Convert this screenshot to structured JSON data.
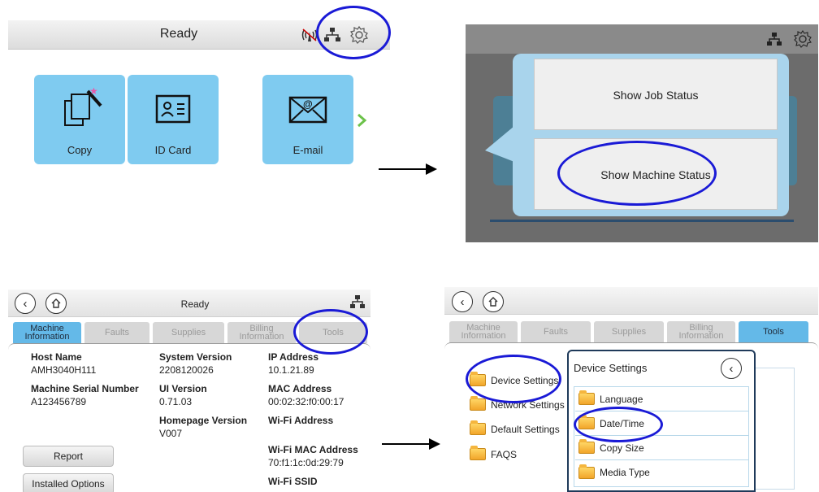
{
  "panel1": {
    "status": "Ready",
    "tiles": [
      {
        "label": "Copy",
        "icon": "copy-icon"
      },
      {
        "label": "ID Card",
        "icon": "id-card-icon"
      },
      {
        "label": "E-mail",
        "icon": "email-icon"
      }
    ],
    "next_icon": "chevron-right-icon"
  },
  "panel2": {
    "buttons": [
      "Show Job Status",
      "Show Machine Status"
    ]
  },
  "panel3": {
    "status": "Ready",
    "tabs": [
      "Machine Information",
      "Faults",
      "Supplies",
      "Billing Information",
      "Tools"
    ],
    "active_tab": "Machine Information",
    "info": {
      "host_name": {
        "label": "Host Name",
        "value": "AMH3040H111"
      },
      "serial": {
        "label": "Machine Serial Number",
        "value": "A123456789"
      },
      "system_version": {
        "label": "System Version",
        "value": "2208120026"
      },
      "ui_version": {
        "label": "UI Version",
        "value": "0.71.03"
      },
      "homepage_version": {
        "label": "Homepage Version",
        "value": "V007"
      },
      "ip": {
        "label": "IP Address",
        "value": "10.1.21.89"
      },
      "mac": {
        "label": "MAC Address",
        "value": "00:02:32:f0:00:17"
      },
      "wifi": {
        "label": "Wi-Fi Address",
        "value": ""
      },
      "wifi_mac": {
        "label": "Wi-Fi MAC Address",
        "value": "70:f1:1c:0d:29:79"
      },
      "wifi_ssid": {
        "label": "Wi-Fi SSID",
        "value": ""
      }
    },
    "buttons": [
      "Report",
      "Installed Options"
    ]
  },
  "panel4": {
    "tabs": [
      "Machine Information",
      "Faults",
      "Supplies",
      "Billing Information",
      "Tools"
    ],
    "active_tab": "Tools",
    "folders": [
      "Device Settings",
      "Network Settings",
      "Default Settings",
      "FAQS"
    ],
    "popup_title": "Device Settings",
    "popup_items": [
      "Language",
      "Date/Time",
      "Copy Size",
      "Media Type"
    ]
  },
  "colors": {
    "accent": "#64b9e8",
    "tile": "#7fcbf0",
    "highlight": "#1a1ad6",
    "next": "#6cc24a"
  }
}
